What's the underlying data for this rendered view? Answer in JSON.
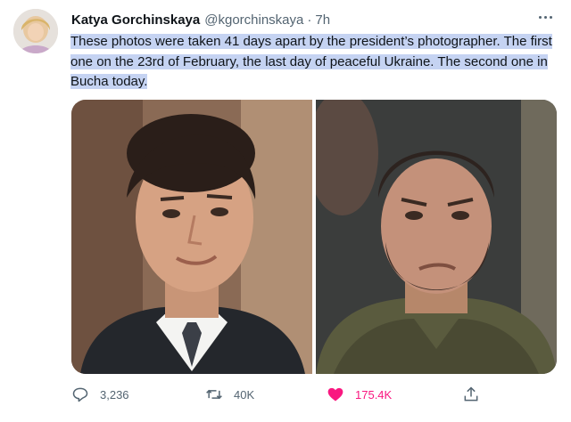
{
  "tweet": {
    "display_name": "Katya Gorchinskaya",
    "handle": "@kgorchinskaya",
    "separator": "·",
    "time": "7h",
    "text": "These photos were taken 41 days apart by the president’s photographer. The first one on the 23rd of February, the last day of peaceful Ukraine. The second one in Bucha today."
  },
  "icons": {
    "more": "more-icon",
    "reply": "reply-icon",
    "retweet": "retweet-icon",
    "like": "heart-icon",
    "share": "share-icon"
  },
  "actions": {
    "replies": "3,236",
    "retweets": "40K",
    "likes": "175.4K"
  },
  "colors": {
    "highlight": "#c5d3f2",
    "like": "#f91880",
    "secondary_text": "#536471"
  }
}
